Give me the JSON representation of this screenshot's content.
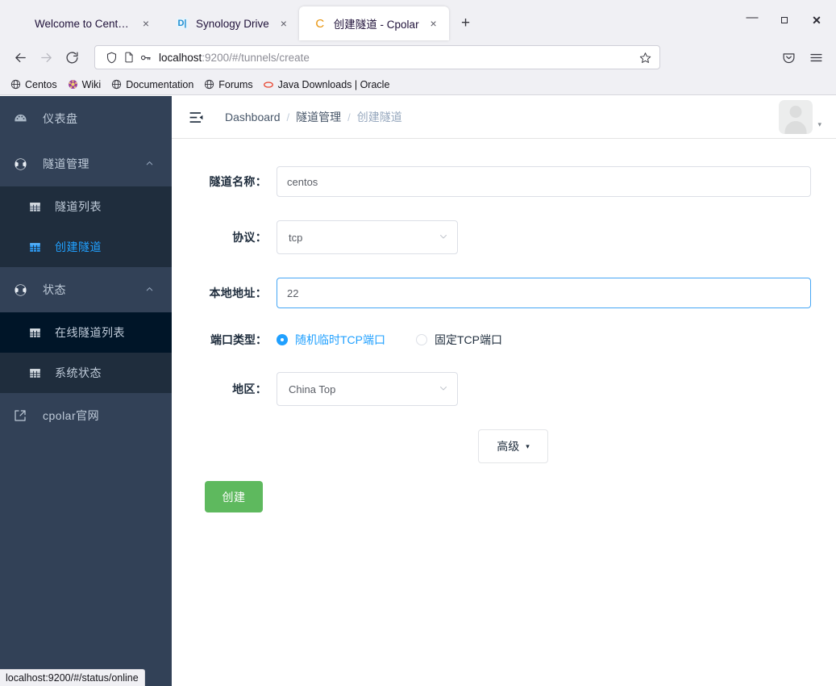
{
  "browser": {
    "tabs": [
      {
        "title": "Welcome to CentOS",
        "favicon": "none",
        "active": false,
        "close_label": "×"
      },
      {
        "title": "Synology Drive",
        "favicon": "synology-drive-icon",
        "favicon_text": "D|",
        "active": false,
        "close_label": "×"
      },
      {
        "title": "创建隧道 - Cpolar",
        "favicon": "cpolar-icon",
        "favicon_text": "C",
        "active": true,
        "close_label": "×"
      }
    ],
    "new_tab_label": "+",
    "window_controls": {
      "minimize": "–",
      "maximize": "▫",
      "close": "✕"
    },
    "nav": {
      "back": "←",
      "forward": "→",
      "reload": "↻"
    },
    "url": {
      "host": "localhost",
      "path": ":9200/#/tunnels/create",
      "full": "localhost:9200/#/tunnels/create"
    },
    "bookmarks": [
      {
        "label": "Centos",
        "icon": "globe-icon"
      },
      {
        "label": "Wiki",
        "icon": "wiki-icon"
      },
      {
        "label": "Documentation",
        "icon": "globe-icon"
      },
      {
        "label": "Forums",
        "icon": "globe-icon"
      },
      {
        "label": "Java Downloads | Oracle",
        "icon": "oracle-icon"
      }
    ],
    "status_text": "localhost:9200/#/status/online"
  },
  "sidebar": {
    "items": [
      {
        "label": "仪表盘",
        "icon": "dashboard-icon",
        "type": "item"
      },
      {
        "label": "隧道管理",
        "icon": "tunnel-icon",
        "type": "group",
        "caret": "⌃"
      },
      {
        "label": "隧道列表",
        "icon": "table-icon",
        "type": "sub"
      },
      {
        "label": "创建隧道",
        "icon": "table-icon-active",
        "type": "sub",
        "active": true
      },
      {
        "label": "状态",
        "icon": "status-icon",
        "type": "group",
        "caret": "⌃"
      },
      {
        "label": "在线隧道列表",
        "icon": "table-icon",
        "type": "sub",
        "hovered": true
      },
      {
        "label": "系统状态",
        "icon": "table-icon",
        "type": "sub"
      },
      {
        "label": "cpolar官网",
        "icon": "external-link-icon",
        "type": "link"
      }
    ]
  },
  "header": {
    "fold_icon": "menu-fold-icon",
    "breadcrumb": [
      "Dashboard",
      "隧道管理",
      "创建隧道"
    ],
    "separator": "/",
    "avatar": "user-avatar",
    "caret": "▾"
  },
  "form": {
    "tunnel_name": {
      "label": "隧道名称：",
      "value": "centos"
    },
    "protocol": {
      "label": "协议：",
      "value": "tcp",
      "caret": "∨"
    },
    "local_address": {
      "label": "本地地址：",
      "value": "22"
    },
    "port_type": {
      "label": "端口类型：",
      "options": [
        {
          "label": "随机临时TCP端口",
          "checked": true
        },
        {
          "label": "固定TCP端口",
          "checked": false
        }
      ]
    },
    "region": {
      "label": "地区：",
      "value": "China Top",
      "caret": "∨"
    },
    "advanced": {
      "label": "高级",
      "caret": "▾"
    },
    "submit": {
      "label": "创建"
    }
  },
  "colors": {
    "sidebar_bg": "#324157",
    "submenu_bg": "#1f2d3d",
    "active_item_bg": "#001528",
    "accent_blue": "#20a0ff",
    "create_green": "#5eb95e",
    "text_light": "#bfcbd9"
  }
}
